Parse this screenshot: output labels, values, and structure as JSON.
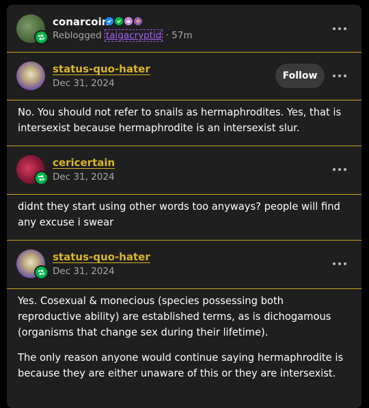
{
  "reblogger": {
    "name": "conarcoin",
    "reblogged_prefix": "Reblogged",
    "reblogged_from": "taigacryptid",
    "time": "· 57m"
  },
  "posts": [
    {
      "author": "status-quo-hater",
      "date": "Dec 31, 2024",
      "follow_label": "Follow",
      "paragraphs": [
        "No. You should not refer to snails as hermaphrodites. Yes, that is intersexist because hermaphrodite is an intersexist slur."
      ]
    },
    {
      "author": "cericertain",
      "date": "Dec 31, 2024",
      "paragraphs": [
        "didnt they start using other words too anyways? people will find any excuse i swear"
      ]
    },
    {
      "author": "status-quo-hater",
      "date": "Dec 31, 2024",
      "paragraphs": [
        "Yes. Cosexual & monecious (species possessing both reproductive ability) are established terms, as is dichogamous (organisms that change sex during their lifetime).",
        "The only reason anyone would continue saying hermaphrodite is because they are either unaware of this or they are intersexist."
      ]
    }
  ],
  "colors": {
    "accent_link": "#d9b62a",
    "reblog_green": "#00b64b",
    "reblogged_from_purple": "#a663ff",
    "card_bg": "#1f1f1f"
  }
}
